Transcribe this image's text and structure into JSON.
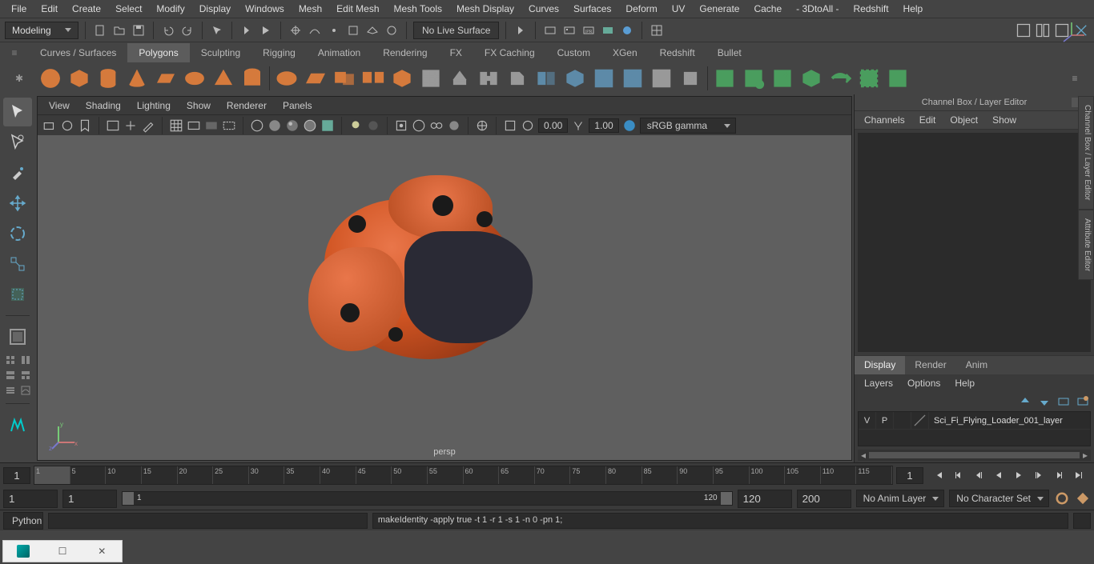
{
  "menubar": [
    "File",
    "Edit",
    "Create",
    "Select",
    "Modify",
    "Display",
    "Windows",
    "Mesh",
    "Edit Mesh",
    "Mesh Tools",
    "Mesh Display",
    "Curves",
    "Surfaces",
    "Deform",
    "UV",
    "Generate",
    "Cache",
    "- 3DtoAll -",
    "Redshift",
    "Help"
  ],
  "workspace": "Modeling",
  "no_live_surface": "No Live Surface",
  "shelf_tabs": [
    "Curves / Surfaces",
    "Polygons",
    "Sculpting",
    "Rigging",
    "Animation",
    "Rendering",
    "FX",
    "FX Caching",
    "Custom",
    "XGen",
    "Redshift",
    "Bullet"
  ],
  "shelf_active": "Polygons",
  "viewport_menu": [
    "View",
    "Shading",
    "Lighting",
    "Show",
    "Renderer",
    "Panels"
  ],
  "viewport_num1": "0.00",
  "viewport_num2": "1.00",
  "viewport_colorspace": "sRGB gamma",
  "viewport_camera": "persp",
  "channel_box": {
    "title": "Channel Box / Layer Editor",
    "menu": [
      "Channels",
      "Edit",
      "Object",
      "Show"
    ],
    "tabs": [
      "Display",
      "Render",
      "Anim"
    ],
    "active_tab": "Display",
    "layer_menu": [
      "Layers",
      "Options",
      "Help"
    ],
    "layer": {
      "v": "V",
      "p": "P",
      "name": "Sci_Fi_Flying_Loader_001_layer"
    }
  },
  "edge_tabs": [
    "Channel Box / Layer Editor",
    "Attribute Editor"
  ],
  "timeline": {
    "start_field": "1",
    "end_field": "1",
    "ticks": [
      "1",
      "5",
      "10",
      "15",
      "20",
      "25",
      "30",
      "35",
      "40",
      "45",
      "50",
      "55",
      "60",
      "65",
      "70",
      "75",
      "80",
      "85",
      "90",
      "95",
      "100",
      "105",
      "110",
      "115"
    ],
    "range_start": "1",
    "range_inner_start": "1",
    "range_inner_end": "120",
    "range_out_end": "120",
    "range_out_end2": "200",
    "anim_layer": "No Anim Layer",
    "char_set": "No Character Set"
  },
  "cmdline": {
    "lang": "Python",
    "output": "makeIdentity -apply true -t 1 -r 1 -s 1 -n 0 -pn 1;"
  }
}
